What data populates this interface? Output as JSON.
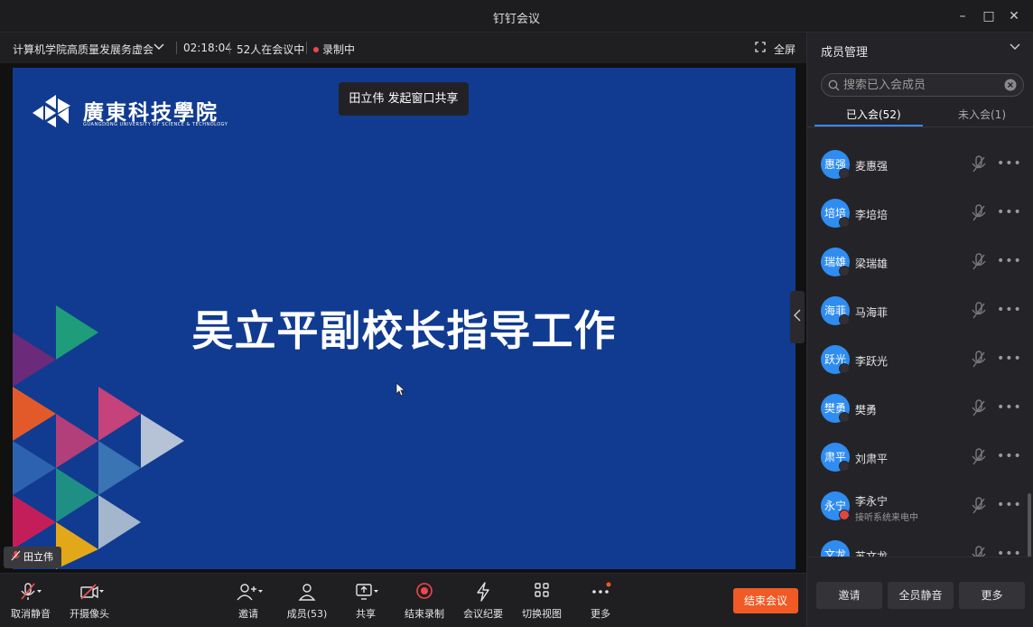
{
  "window": {
    "title": "钉钉会议",
    "minimize": "–",
    "maximize": "□",
    "close": "✕"
  },
  "meeting": {
    "name": "计算机学院高质量发展务虚会",
    "duration": "02:18:04",
    "participants": "52人在会议中",
    "recording": "录制中",
    "fullscreen": "全屏"
  },
  "slide": {
    "logo_text": "廣東科技學院",
    "logo_sub": "GUANGDONG UNIVERSITY OF SCIENCE & TECHNOLOGY",
    "title": "吴立平副校长指导工作"
  },
  "toast": "田立伟 发起窗口共享",
  "speaker_tag": "田立伟",
  "toolbar": {
    "unmute": "取消静音",
    "camera": "开摄像头",
    "invite": "邀请",
    "members": "成员(53)",
    "share": "共享",
    "stop_record": "结束录制",
    "minutes": "会议纪要",
    "switch_view": "切换视图",
    "more": "更多",
    "end_meeting": "结束会议"
  },
  "panel": {
    "title": "成员管理",
    "search_placeholder": "搜索已入会成员",
    "tab_joined": "已入会(52)",
    "tab_not_joined": "未入会(1)",
    "members": [
      {
        "avatar": "惠强",
        "name": "麦惠强",
        "status": ""
      },
      {
        "avatar": "培培",
        "name": "李培培",
        "status": ""
      },
      {
        "avatar": "瑞雄",
        "name": "梁瑞雄",
        "status": ""
      },
      {
        "avatar": "海菲",
        "name": "马海菲",
        "status": ""
      },
      {
        "avatar": "跃光",
        "name": "李跃光",
        "status": ""
      },
      {
        "avatar": "樊勇",
        "name": "樊勇",
        "status": ""
      },
      {
        "avatar": "肃平",
        "name": "刘肃平",
        "status": ""
      },
      {
        "avatar": "永宁",
        "name": "李永宁",
        "status": "接听系统来电中"
      },
      {
        "avatar": "文龙",
        "name": "苏文龙",
        "status": ""
      }
    ],
    "footer_invite": "邀请",
    "footer_mute_all": "全员静音",
    "footer_more": "更多"
  }
}
